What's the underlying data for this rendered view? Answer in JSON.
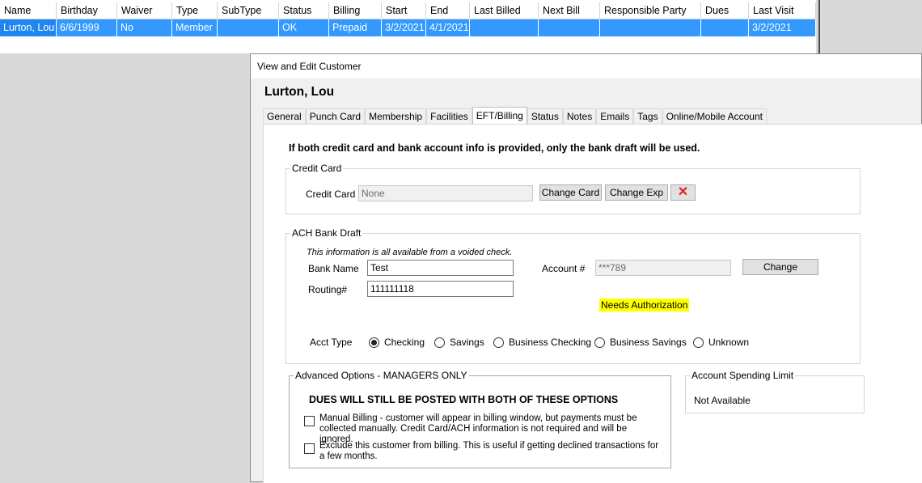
{
  "grid": {
    "columns": [
      "Name",
      "Birthday",
      "Waiver",
      "Type",
      "SubType",
      "Status",
      "Billing",
      "Start",
      "End",
      "Last Billed",
      "Next Bill",
      "Responsible Party",
      "Dues",
      "Last Visit"
    ],
    "row": [
      "Lurton, Lou",
      "6/6/1999",
      "No",
      "Member",
      "",
      "OK",
      "Prepaid",
      "3/2/2021",
      "4/1/2021",
      "",
      "",
      "",
      "",
      "3/2/2021"
    ]
  },
  "dialog": {
    "title": "View and Edit Customer",
    "customer_name": "Lurton, Lou",
    "tabs": [
      "General",
      "Punch Card",
      "Membership",
      "Facilities",
      "EFT/Billing",
      "Status",
      "Notes",
      "Emails",
      "Tags",
      "Online/Mobile Account"
    ],
    "active_tab": "EFT/Billing"
  },
  "eft": {
    "notice": "If both credit card and bank account info is provided, only the bank draft will be used.",
    "credit_card": {
      "group_label": "Credit Card",
      "field_label": "Credit Card",
      "value": "None",
      "change_card": "Change Card",
      "change_exp": "Change Exp",
      "delete_symbol": "✕"
    },
    "ach": {
      "group_label": "ACH Bank Draft",
      "hint": "This information is all available from a voided check.",
      "bank_name_label": "Bank Name",
      "bank_name": "Test",
      "routing_label": "Routing#",
      "routing": "111111118",
      "account_label": "Account #",
      "account": "***789",
      "change": "Change",
      "needs_auth": "Needs Authorization",
      "acct_type_label": "Acct Type",
      "acct_types": [
        "Checking",
        "Savings",
        "Business Checking",
        "Business Savings",
        "Unknown"
      ],
      "selected_type": "Checking"
    },
    "advanced": {
      "group_label": "Advanced Options - MANAGERS ONLY",
      "warning": "DUES WILL STILL BE POSTED WITH BOTH OF THESE OPTIONS",
      "manual_billing": "Manual Billing - customer will appear in billing window, but payments must be collected manually. Credit Card/ACH information is not required and will be ignored.",
      "exclude_billing": "Exclude this customer from billing.  This is useful if getting declined transactions for a few months."
    },
    "spending": {
      "group_label": "Account Spending Limit",
      "value": "Not Available"
    }
  },
  "colors": {
    "selection": "#3399ff",
    "highlight": "#ffff00",
    "delete": "#e02020"
  }
}
